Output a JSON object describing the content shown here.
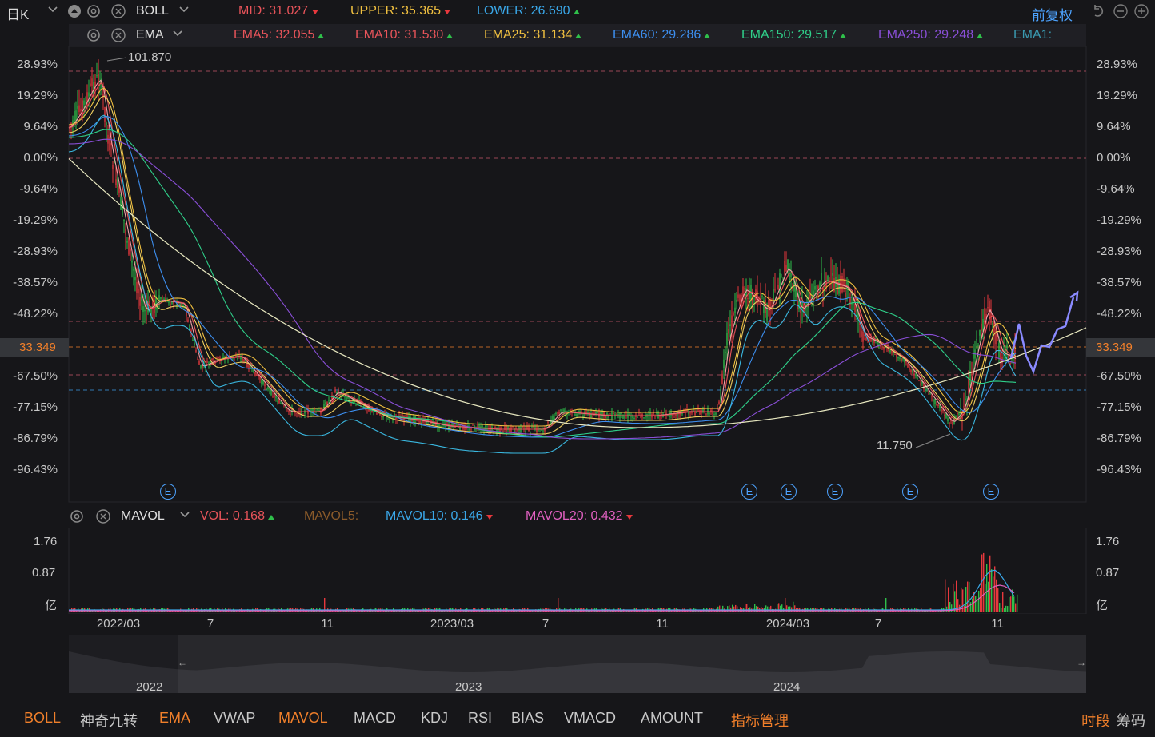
{
  "top_bar": {
    "period_label": "日K",
    "indicator_name": "BOLL",
    "mid_label": "MID:",
    "mid_value": "31.027",
    "upper_label": "UPPER:",
    "upper_value": "35.365",
    "lower_label": "LOWER:",
    "lower_value": "26.690",
    "adjust_label": "前复权"
  },
  "ema_bar": {
    "indicator_name": "EMA",
    "items": [
      {
        "label": "EMA5:",
        "value": "32.055",
        "color": "#e8545a"
      },
      {
        "label": "EMA10:",
        "value": "31.530",
        "color": "#e8545a"
      },
      {
        "label": "EMA25:",
        "value": "31.134",
        "color": "#f0c040"
      },
      {
        "label": "EMA60:",
        "value": "29.286",
        "color": "#3d8ff0"
      },
      {
        "label": "EMA150:",
        "value": "29.517",
        "color": "#2fd08a"
      },
      {
        "label": "EMA250:",
        "value": "29.248",
        "color": "#8a4fd8"
      },
      {
        "label": "EMA1:",
        "value": "",
        "color": "#3a9ab0"
      }
    ]
  },
  "price_axis": {
    "left_ticks": [
      "28.93%",
      "19.29%",
      "9.64%",
      "0.00%",
      "-9.64%",
      "-19.29%",
      "-28.93%",
      "-38.57%",
      "-48.22%",
      "-67.50%",
      "-77.15%",
      "-86.79%",
      "-96.43%"
    ],
    "right_ticks": [
      "28.93%",
      "19.29%",
      "9.64%",
      "0.00%",
      "-9.64%",
      "-19.29%",
      "-28.93%",
      "-38.57%",
      "-48.22%",
      "-67.50%",
      "-77.15%",
      "-86.79%",
      "-96.43%"
    ],
    "current_price": "33.349",
    "high_marker": "101.870",
    "low_marker": "11.750",
    "event_marker": "E"
  },
  "vol_bar": {
    "indicator_name": "MAVOL",
    "vol_label": "VOL:",
    "vol_value": "0.168",
    "mavol5_label": "MAVOL5:",
    "mavol10_label": "MAVOL10:",
    "mavol10_value": "0.146",
    "mavol20_label": "MAVOL20:",
    "mavol20_value": "0.432",
    "ticks": [
      "1.76",
      "0.87",
      "亿"
    ]
  },
  "x_axis": [
    "2022/03",
    "7",
    "11",
    "2023/03",
    "7",
    "11",
    "2024/03",
    "7",
    "11"
  ],
  "navigator": {
    "years": [
      "2022",
      "2023",
      "2024"
    ],
    "left_arrow": "←",
    "right_arrow": "→"
  },
  "bottom_tabs": [
    {
      "label": "BOLL",
      "active": true
    },
    {
      "label": "神奇九转",
      "active": false
    },
    {
      "label": "EMA",
      "active": true
    },
    {
      "label": "VWAP",
      "active": false
    },
    {
      "label": "MAVOL",
      "active": true
    },
    {
      "label": "MACD",
      "active": false
    },
    {
      "label": "KDJ",
      "active": false
    },
    {
      "label": "RSI",
      "active": false
    },
    {
      "label": "BIAS",
      "active": false
    },
    {
      "label": "VMACD",
      "active": false
    },
    {
      "label": "AMOUNT",
      "active": false
    },
    {
      "label": "指标管理",
      "active": true
    }
  ],
  "bottom_right": {
    "time_label": "时段",
    "chips_label": "筹码"
  },
  "colors": {
    "up": "#2fbf4a",
    "down": "#e8383d",
    "accent": "#f07f2a",
    "blue": "#4da3ff",
    "bg": "#161619"
  }
}
